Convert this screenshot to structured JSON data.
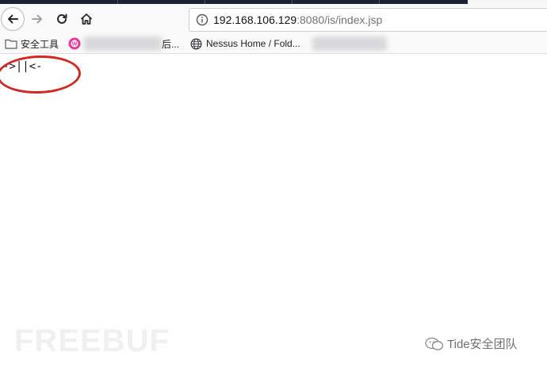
{
  "toolbar": {
    "url_host": "192.168.106.129",
    "url_rest": ":8080/is/index.jsp"
  },
  "bookmarks": {
    "items": [
      {
        "label": "安全工具",
        "icon": "folder-icon"
      },
      {
        "label": "后...",
        "icon": "w-logo-icon"
      },
      {
        "label": "Nessus Home / Fold...",
        "icon": "globe-icon"
      }
    ]
  },
  "page": {
    "output_text": "->||<-"
  },
  "watermark": {
    "freebuf": "FREEBUF",
    "author": "Tide安全团队"
  },
  "colors": {
    "annotation_circle": "#d02a24",
    "tabstrip": "#1e2235"
  }
}
